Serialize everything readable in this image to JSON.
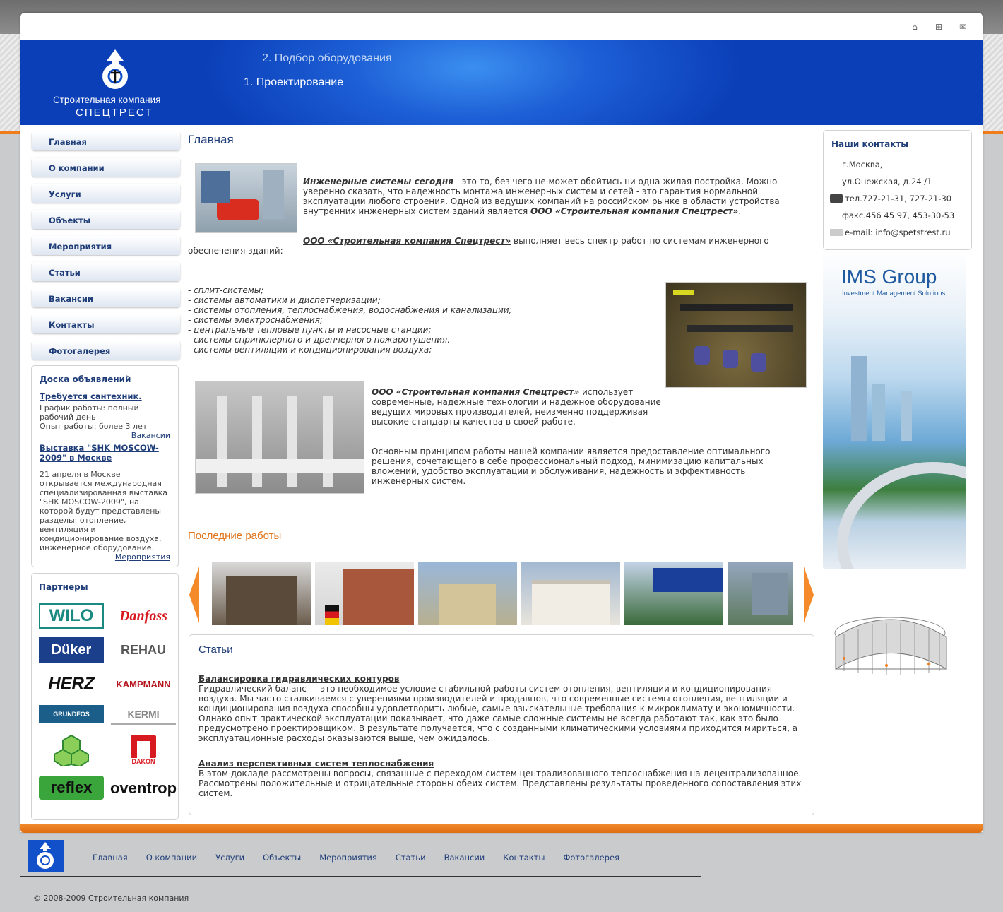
{
  "header": {
    "logo_line1": "Строительная компания",
    "logo_line2": "СПЕЦТРЕСТ",
    "slogan2": "2. Подбор оборудования",
    "slogan1": "1. Проектирование"
  },
  "toplinks": [
    "home-icon",
    "sitemap-icon",
    "mail-icon"
  ],
  "nav": [
    "Главная",
    "О компании",
    "Услуги",
    "Объекты",
    "Мероприятия",
    "Статьи",
    "Вакансии",
    "Контакты",
    "Фотогалерея"
  ],
  "board": {
    "title": "Доска объявлений",
    "item1_link": "Требуется сантехник.",
    "item1_text": "График работы: полный рабочий день\nОпыт работы: более 3 лет",
    "item1_more": "Вакансии",
    "item2_link": "Выставка \"SHK MOSCOW-2009\" в Москве",
    "item2_text": "21 апреля в Москве открывается международная специализированная выставка \"SHK MOSCOW-2009\", на которой будут представлены разделы: отопление, вентиляция и кондиционирование воздуха, инженерное оборудование.",
    "item2_more": "Мероприятия"
  },
  "partners": {
    "title": "Партнеры",
    "logos": [
      "WILO",
      "Danfoss",
      "Düker",
      "REHAU",
      "HERZ",
      "KAMPMANN",
      "GRUNDFOS",
      "KERMI",
      "",
      "DAKON",
      "reflex",
      "oventrop"
    ]
  },
  "main": {
    "title": "Главная",
    "p1_lead": "Инженерные системы сегодня",
    "p1_text": " - это то, без чего не может обойтись ни одна жилая постройка. Можно уверенно сказать, что надежность монтажа инженерных систем и сетей - это гарантия нормальной эксплуатации любого строения. Одной из ведущих компаний на российском рынке в области устройства внутренних инженерных систем зданий является ",
    "company": "ООО «Строительная компания Спецтрест»",
    "p1_end": ".",
    "p2_text": " выполняет весь спектр работ по системам инженерного обеспечения зданий:",
    "list": [
      "- сплит-системы;",
      "- системы автоматики и диспетчеризации;",
      "- системы отопления, теплоснабжения, водоснабжения и канализации;",
      "- системы электроснабжения;",
      "- центральные тепловые пункты и насосные станции;",
      "- системы спринклерного и дренчерного пожаротушения.",
      "- системы вентиляции и кондиционирования воздуха;"
    ],
    "p3_text": " использует современные, надежные технологии и надежное оборудование ведущих мировых производителей, неизменно поддерживая высокие стандарты качества в своей работе.",
    "p4_text": "Основным принципом работы нашей компании является предоставление оптимального решения, сочетающего в себе профессиональный подход, минимизацию капитальных вложений, удобство эксплуатации и обслуживания, надежность и эффективность инженерных систем.",
    "works_title": "Последние работы"
  },
  "articles": {
    "title": "Статьи",
    "a1_title": "Балансировка гидравлических контуров",
    "a1_text": "Гидравлический баланс — это необходимое условие стабильной работы систем отопления, вентиляции и кондиционирования воздуха. Мы часто сталкиваемся с уверениями производителей и продавцов, что современные системы отопления, вентиляции и кондиционирования воздуха способны удовлетворить любые, самые взыскательные требования к микроклимату и экономичности. Однако опыт практической эксплуатации показывает, что даже самые сложные системы не всегда работают так, как это было предусмотрено проектировщиком. В результате получается, что с созданными климатическими условиями приходится мириться, а эксплуатационные расходы оказываются выше, чем ожидалось.",
    "a2_title": "Анализ перспективных систем теплоснабжения",
    "a2_text": "В этом докладе рассмотрены вопросы, связанные с переходом систем централизованного теплоснабжения на децентрализованное. Рассмотрены положительные и отрицательные стороны обеих систем. Представлены результаты проведенного сопоставления этих систем."
  },
  "contacts": {
    "title": "Наши контакты",
    "city": "г.Москва,",
    "street": "ул.Онежская, д.24 /1",
    "phone": "тел.727-21-31, 727-21-30",
    "fax": "факс.456 45 97, 453-30-53",
    "email": "e-mail: info@spetstrest.ru"
  },
  "banner": {
    "title": "IMS Group",
    "subtitle": "Investment Management Solutions"
  },
  "footer": {
    "nav": [
      "Главная",
      "О компании",
      "Услуги",
      "Объекты",
      "Мероприятия",
      "Статьи",
      "Вакансии",
      "Контакты",
      "Фотогалерея"
    ],
    "copyright": "© 2008-2009 Строительная компания"
  },
  "colors": {
    "accent": "#f07d1a",
    "brand_blue": "#1150c8",
    "link": "#1f3d78"
  }
}
